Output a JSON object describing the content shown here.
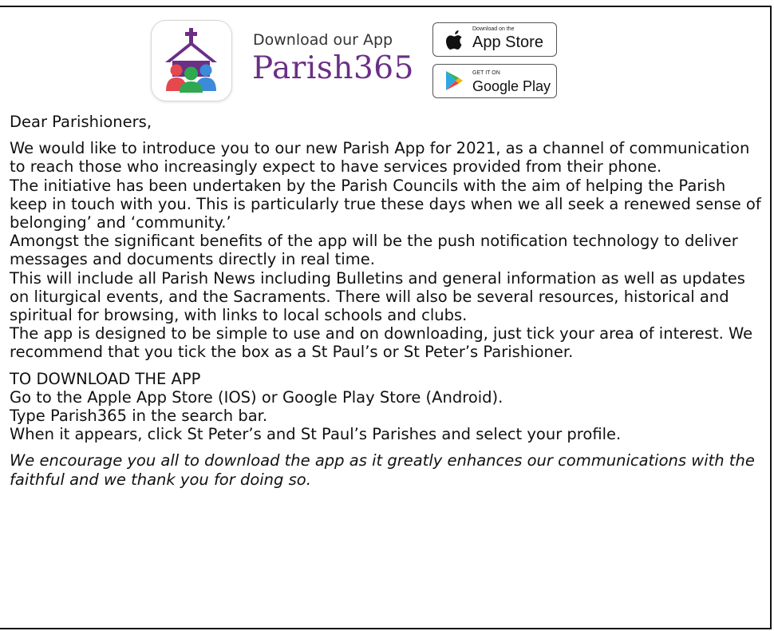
{
  "header": {
    "download_label": "Download our App",
    "brand_name": "Parish365",
    "app_store": {
      "small": "Download on the",
      "big": "App Store"
    },
    "google_play": {
      "small": "GET IT ON",
      "big": "Google Play"
    }
  },
  "letter": {
    "greeting": "Dear Parishioners,",
    "paragraphs": [
      "We would like to introduce you to our new Parish App for 2021, as a channel of communication to reach those who increasingly expect to have services provided from their phone.",
      "The initiative has been undertaken by the Parish Councils with the aim of helping the Parish keep in touch with you. This is particularly true these days when we all seek a renewed sense of belonging’ and ‘community.’",
      "Amongst the significant benefits of the app will be the push notification technology to deliver messages and documents directly in real time.",
      "This will include all Parish News including Bulletins and general information as well as updates on liturgical events, and the Sacraments. There will also be several resources, historical and spiritual for browsing, with links to local schools and clubs.",
      "The app is designed to be simple to use and on downloading, just tick your area of interest. We recommend that you tick the box as a St Paul’s or St Peter’s Parishioner."
    ],
    "instructions_heading": "TO DOWNLOAD THE APP",
    "instructions": [
      "Go to the Apple App Store (IOS) or Google Play Store (Android).",
      "Type Parish365 in the search bar.",
      "When it appears, click St Peter’s and St Paul’s Parishes and select your profile."
    ],
    "closing": "We encourage you all to download the app as it greatly enhances our communications with the faithful and we thank you for doing so."
  },
  "colors": {
    "brand_purple": "#6b2f86",
    "icon_red": "#e5484d",
    "icon_green": "#2fa84f",
    "icon_blue": "#3b8bd9"
  },
  "icons": [
    "parish365-app-icon",
    "apple-logo-icon",
    "google-play-icon"
  ]
}
